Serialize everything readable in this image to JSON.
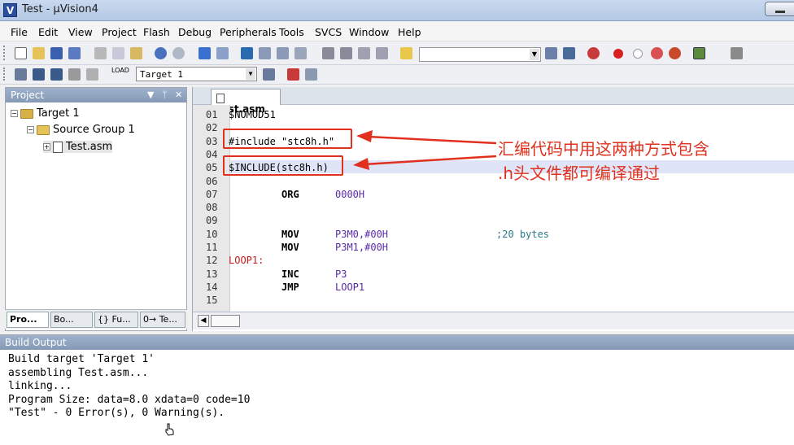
{
  "window": {
    "title": "Test - μVision4",
    "icon_letter": "V"
  },
  "menu": [
    "File",
    "Edit",
    "View",
    "Project",
    "Flash",
    "Debug",
    "Peripherals",
    "Tools",
    "SVCS",
    "Window",
    "Help"
  ],
  "toolbar2": {
    "target_select": "Target 1",
    "load_label": "LOAD"
  },
  "project_panel": {
    "title": "Project",
    "tree": {
      "target": "Target 1",
      "group": "Source Group 1",
      "file": "Test.asm"
    },
    "tabs": [
      "Pro...",
      "Bo...",
      "{} Fu...",
      "0→ Te..."
    ]
  },
  "editor": {
    "tab": "Test.asm",
    "lines": [
      {
        "n": "01",
        "label": "",
        "text": "$NOMOD51"
      },
      {
        "n": "02",
        "label": "",
        "text": ""
      },
      {
        "n": "03",
        "label": "",
        "text": "#include \"stc8h.h\""
      },
      {
        "n": "04",
        "label": "",
        "text": ""
      },
      {
        "n": "05",
        "label": "",
        "text": "$INCLUDE(stc8h.h)"
      },
      {
        "n": "06",
        "label": "",
        "text": ""
      },
      {
        "n": "07",
        "label": "",
        "text": "ORG",
        "operand": "0000H"
      },
      {
        "n": "08",
        "label": "",
        "text": ""
      },
      {
        "n": "09",
        "label": "",
        "text": ""
      },
      {
        "n": "10",
        "label": "",
        "text": "MOV",
        "operand": "P3M0,#00H",
        "comment": ";20 bytes"
      },
      {
        "n": "11",
        "label": "",
        "text": "MOV",
        "operand": "P3M1,#00H"
      },
      {
        "n": "12",
        "label": "LOOP1:",
        "text": ""
      },
      {
        "n": "13",
        "label": "",
        "text": "INC",
        "operand": "P3"
      },
      {
        "n": "14",
        "label": "",
        "text": "JMP",
        "operand": "LOOP1"
      },
      {
        "n": "15",
        "label": "",
        "text": ""
      }
    ]
  },
  "annotation": {
    "line1": "汇编代码中用这两种方式包含",
    "line2": ".h头文件都可编译通过",
    "color": "#e0301e"
  },
  "build_output": {
    "title": "Build Output",
    "lines": [
      "Build target 'Target 1'",
      "assembling Test.asm...",
      "linking...",
      "Program Size: data=8.0 xdata=0 code=10",
      "\"Test\" - 0 Error(s), 0 Warning(s)."
    ]
  }
}
